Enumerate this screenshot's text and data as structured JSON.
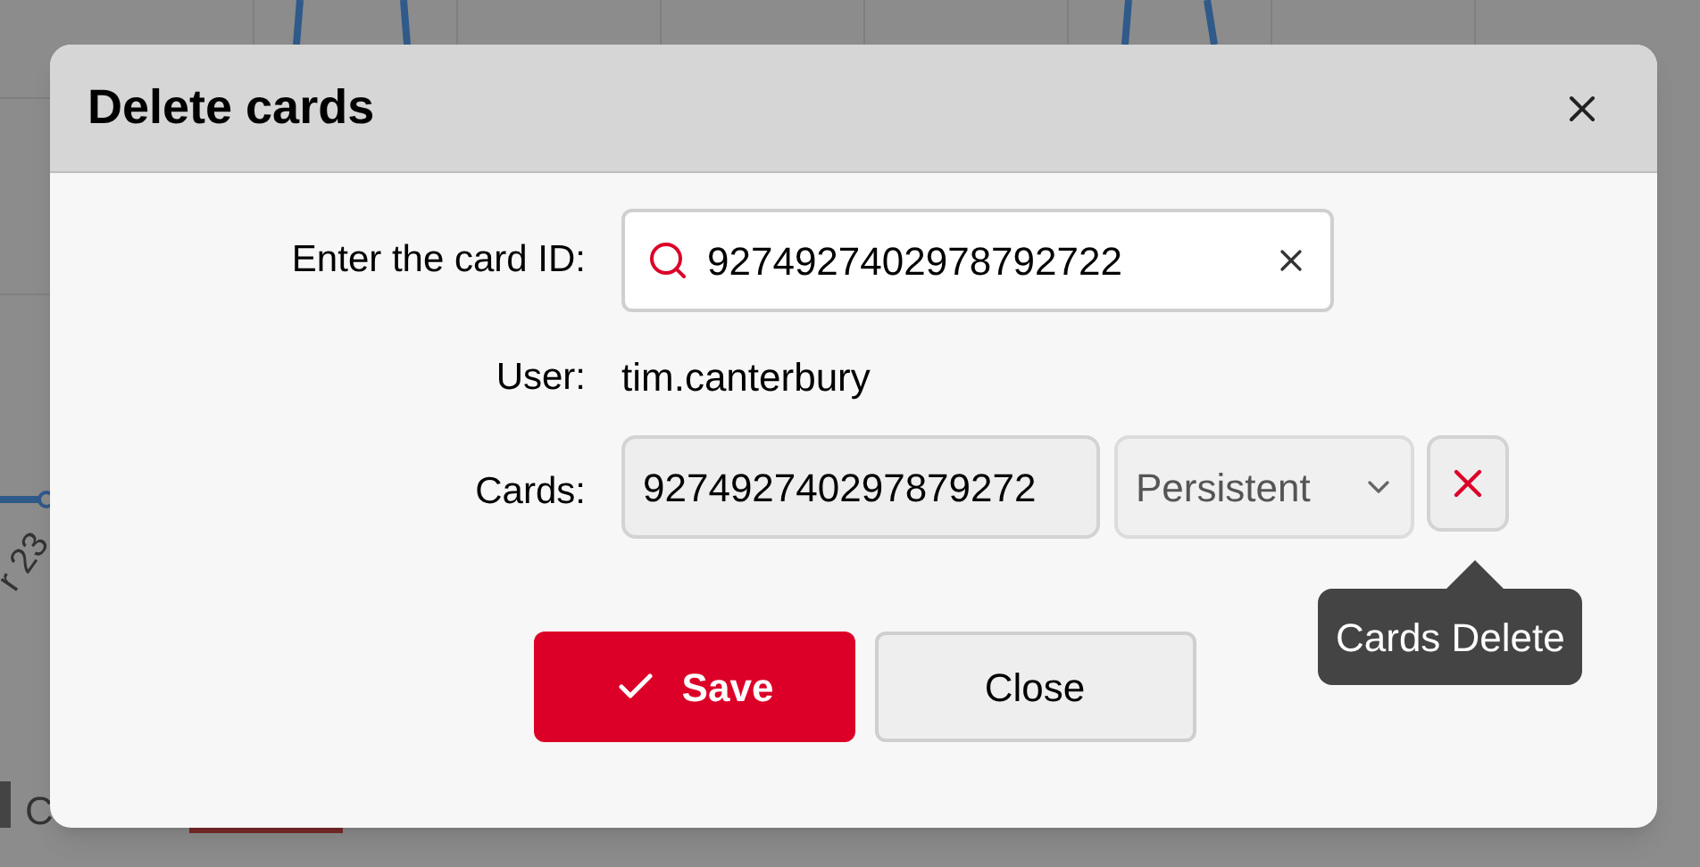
{
  "background": {
    "axis_label": "r 23",
    "legend_label": "C"
  },
  "dialog": {
    "title": "Delete cards",
    "search": {
      "label": "Enter the card ID:",
      "value": "9274927402978792722"
    },
    "user": {
      "label": "User:",
      "value": "tim.canterbury"
    },
    "cards": {
      "label": "Cards:",
      "value": "927492740297879272",
      "type": "Persistent",
      "delete_tooltip": "Cards Delete"
    },
    "buttons": [
      {
        "kind": "primary",
        "label": "Save"
      },
      {
        "kind": "secondary",
        "label": "Close"
      }
    ]
  }
}
